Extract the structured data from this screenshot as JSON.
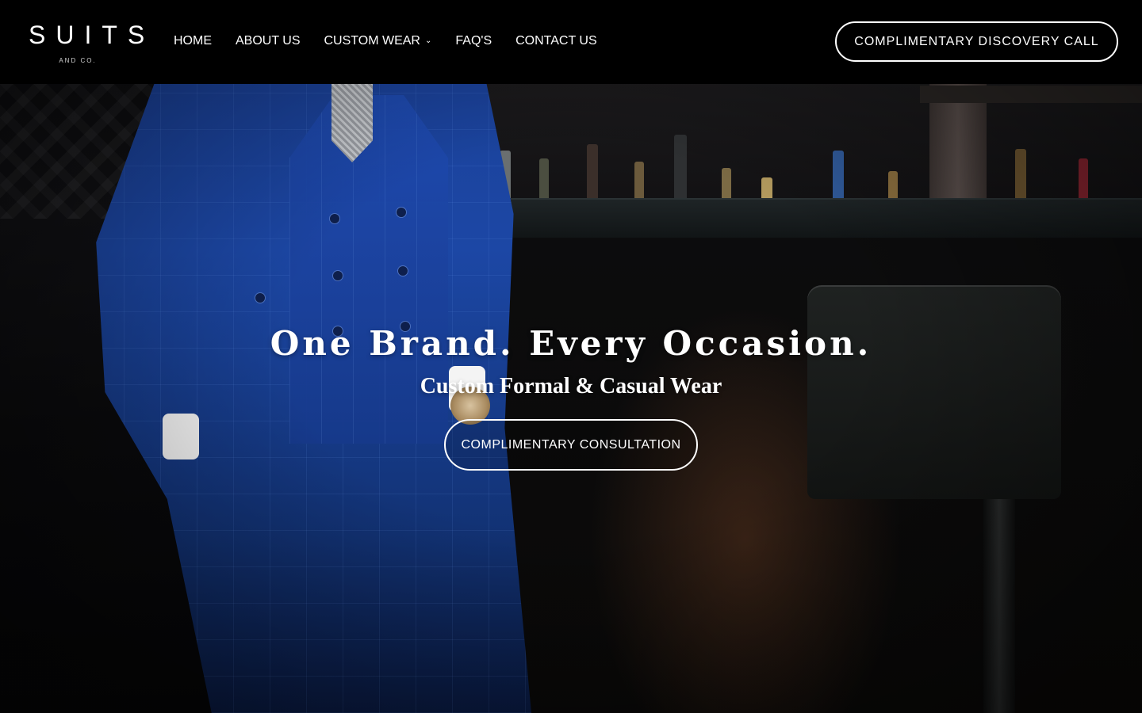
{
  "brand": {
    "name": "SUITS",
    "tagline": "AND CO."
  },
  "nav": {
    "items": [
      {
        "label": "HOME"
      },
      {
        "label": "ABOUT US"
      },
      {
        "label": "CUSTOM WEAR",
        "has_dropdown": true,
        "icon": "chevron-down-icon"
      },
      {
        "label": "FAQ'S"
      },
      {
        "label": "CONTACT US"
      }
    ]
  },
  "header_cta": {
    "label": "COMPLIMENTARY DISCOVERY CALL"
  },
  "hero": {
    "title": "One Brand. Every Occasion.",
    "subtitle": "Custom Formal & Casual Wear",
    "cta_label": "COMPLIMENTARY CONSULTATION"
  },
  "colors": {
    "header_bg": "#000000",
    "text": "#ffffff",
    "suit_blue": "#1c47a5"
  }
}
